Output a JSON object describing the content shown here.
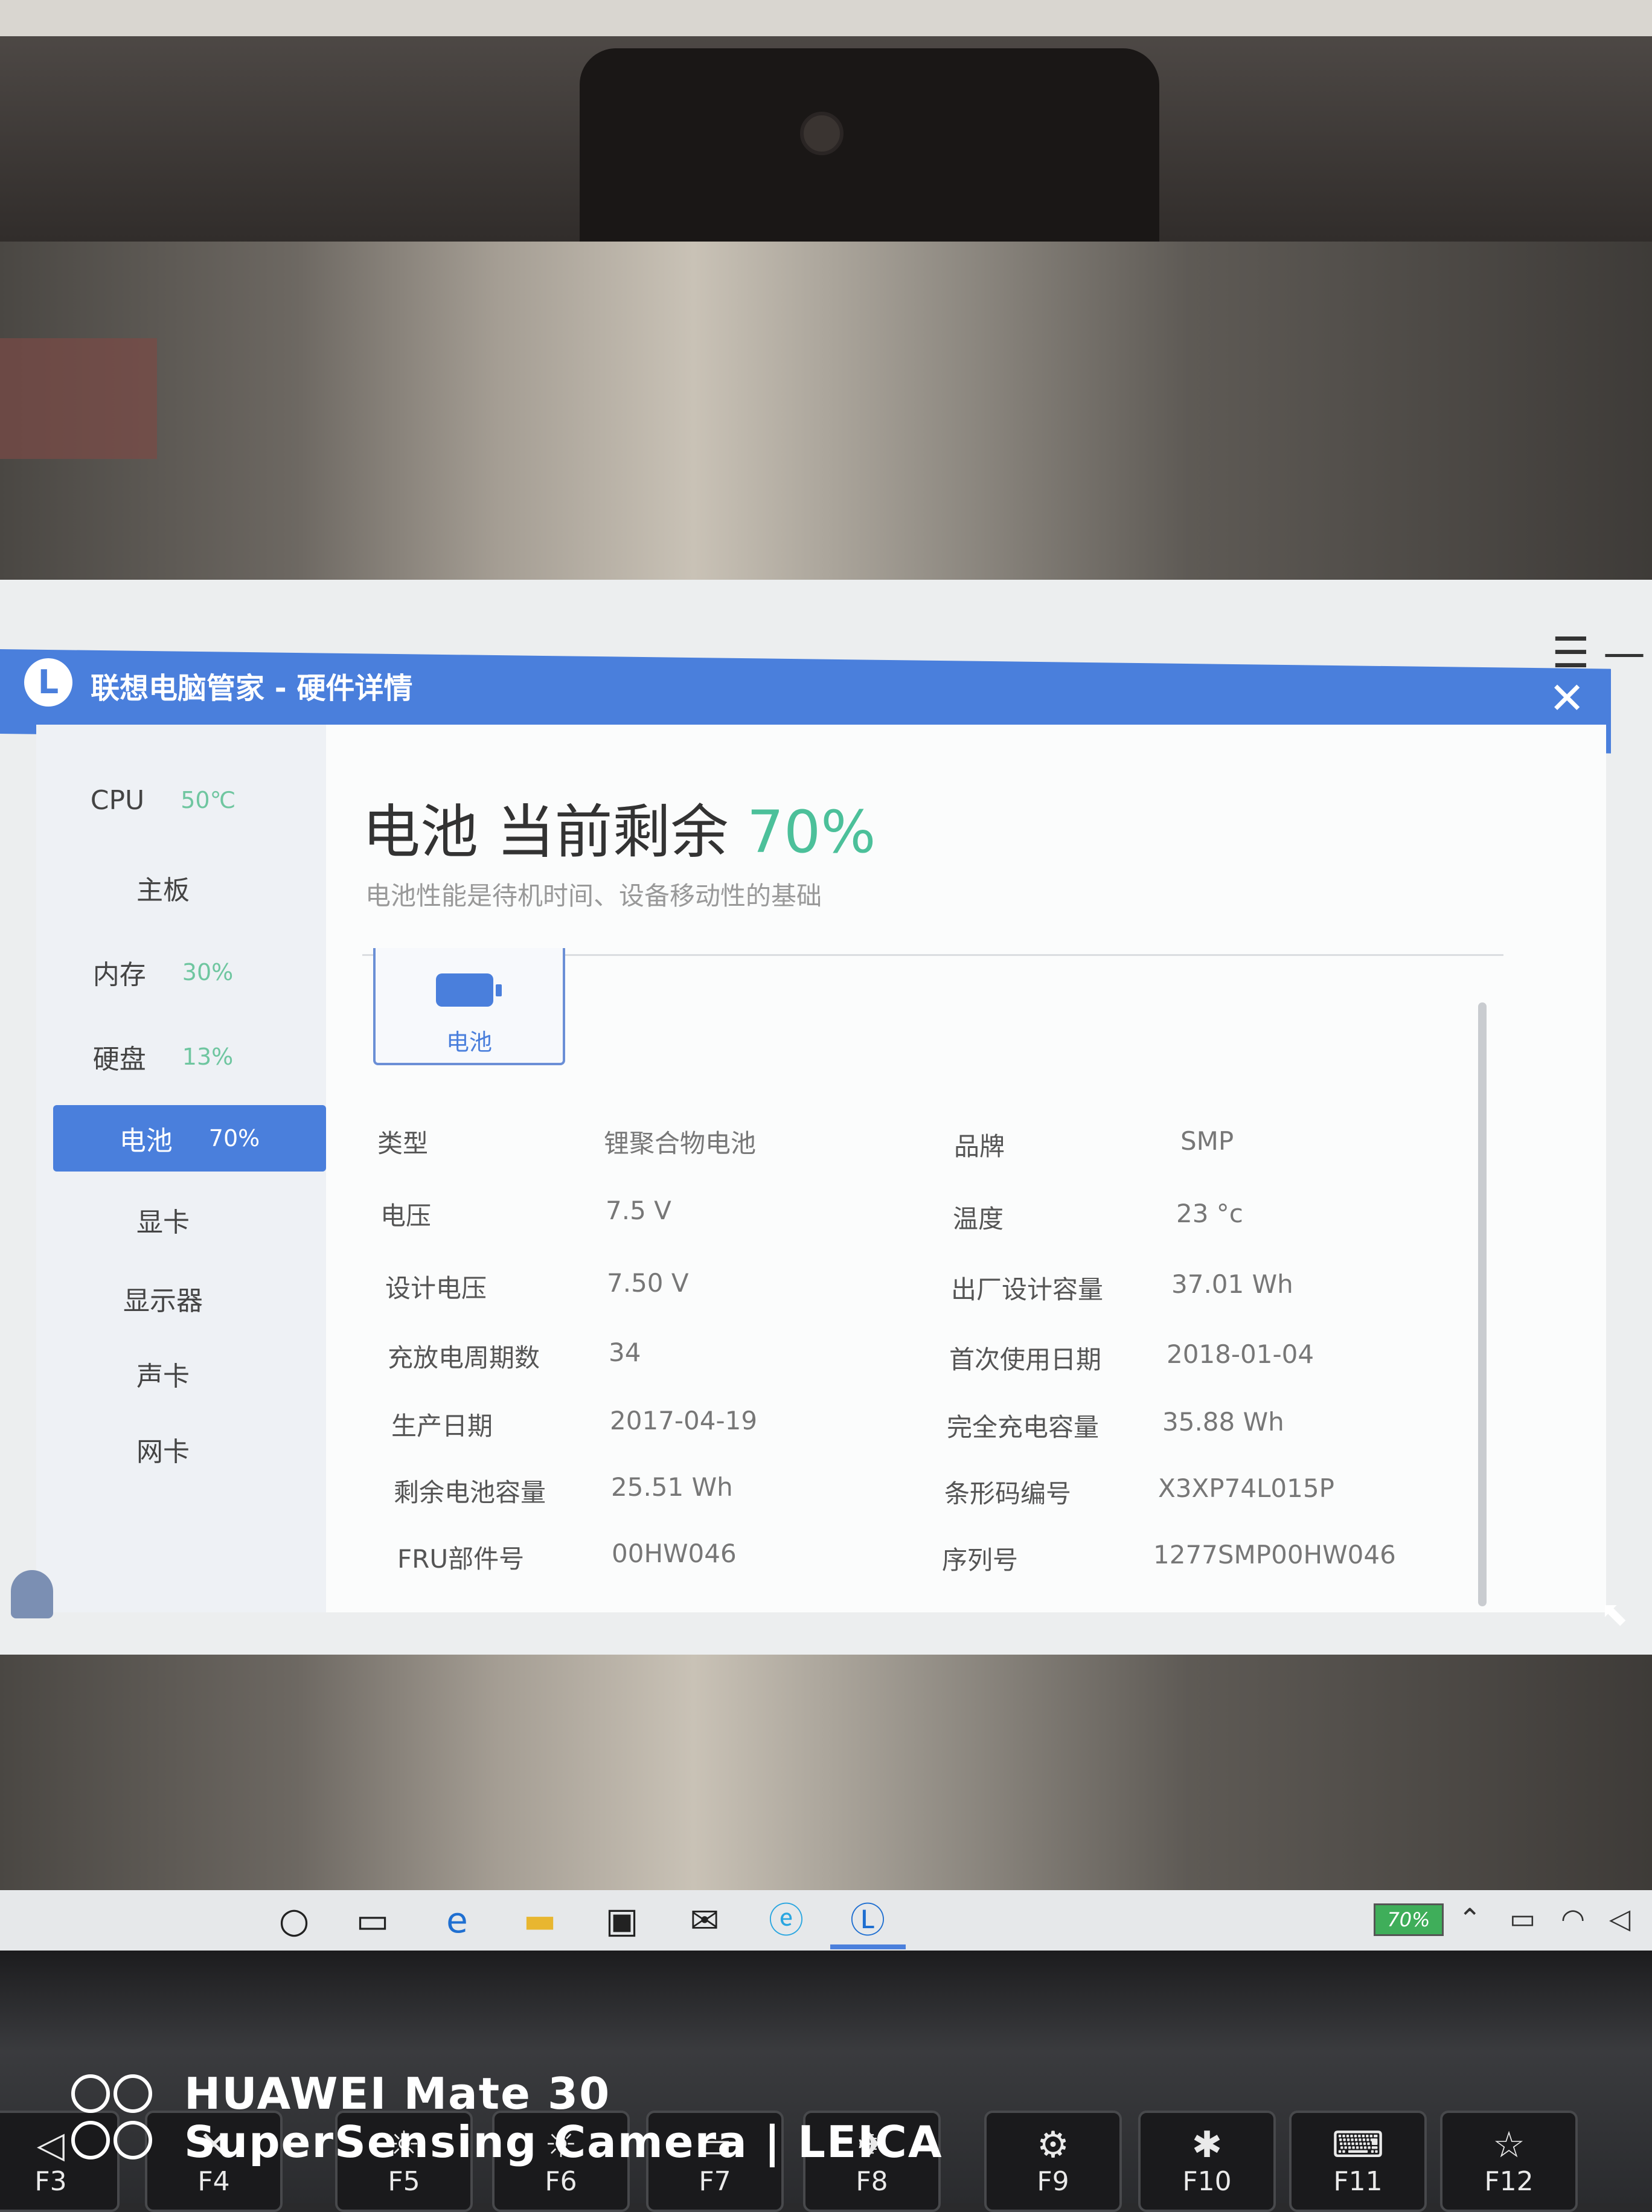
{
  "window": {
    "title": "联想电脑管家 - 硬件详情",
    "logo_letter": "L",
    "close_label": "✕",
    "controls": "☰  —"
  },
  "sidebar": {
    "items": [
      {
        "label": "CPU",
        "value": "50℃"
      },
      {
        "label": "主板",
        "value": ""
      },
      {
        "label": "内存",
        "value": "30%"
      },
      {
        "label": "硬盘",
        "value": "13%"
      },
      {
        "label": "电池",
        "value": "70%"
      },
      {
        "label": "显卡",
        "value": ""
      },
      {
        "label": "显示器",
        "value": ""
      },
      {
        "label": "声卡",
        "value": ""
      },
      {
        "label": "网卡",
        "value": ""
      }
    ],
    "active_index": 4
  },
  "main": {
    "heading_prefix": "电池 当前剩余 ",
    "heading_pct": "70%",
    "subtitle": "电池性能是待机时间、设备移动性的基础",
    "tab_label": "电池",
    "left_rows": [
      {
        "label": "类型",
        "value": "锂聚合物电池"
      },
      {
        "label": "电压",
        "value": "7.5 V"
      },
      {
        "label": "设计电压",
        "value": "7.50 V"
      },
      {
        "label": "充放电周期数",
        "value": "34"
      },
      {
        "label": "生产日期",
        "value": "2017-04-19"
      },
      {
        "label": "剩余电池容量",
        "value": "25.51 Wh"
      },
      {
        "label": "FRU部件号",
        "value": "00HW046"
      }
    ],
    "right_rows": [
      {
        "label": "品牌",
        "value": "SMP"
      },
      {
        "label": "温度",
        "value": "23 °c"
      },
      {
        "label": "出厂设计容量",
        "value": "37.01 Wh"
      },
      {
        "label": "首次使用日期",
        "value": "2018-01-04"
      },
      {
        "label": "完全充电容量",
        "value": "35.88 Wh"
      },
      {
        "label": "条形码编号",
        "value": "X3XP74L015P"
      },
      {
        "label": "序列号",
        "value": "1277SMP00HW046"
      }
    ]
  },
  "taskbar": {
    "icons": [
      "search-circle-icon",
      "task-view-icon",
      "edge-icon",
      "file-explorer-icon",
      "store-icon",
      "mail-icon",
      "ie-icon",
      "lenovo-icon"
    ],
    "battery_text": "70%"
  },
  "keyboard": {
    "keys": [
      "F3",
      "F4",
      "F5",
      "F6",
      "F7",
      "F8",
      "F9",
      "F10",
      "F11",
      "F12"
    ]
  },
  "watermark": {
    "line1": "HUAWEI Mate 30",
    "line2": "SuperSensing Camera | LEICA"
  }
}
